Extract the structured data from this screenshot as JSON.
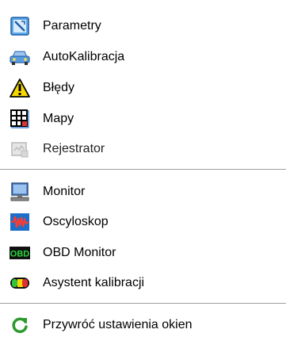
{
  "menu": {
    "items": [
      {
        "label": "Parametry",
        "icon": "parameters-icon"
      },
      {
        "label": "AutoKalibracja",
        "icon": "car-icon"
      },
      {
        "label": "Błędy",
        "icon": "warning-icon"
      },
      {
        "label": "Mapy",
        "icon": "map-grid-icon"
      },
      {
        "label": "Rejestrator",
        "icon": "recorder-icon",
        "disabled": true
      },
      {
        "label": "Monitor",
        "icon": "monitor-icon"
      },
      {
        "label": "Oscyloskop",
        "icon": "oscilloscope-icon"
      },
      {
        "label": "OBD Monitor",
        "icon": "obd-icon",
        "icon_text": "OBD"
      },
      {
        "label": "Asystent kalibracji",
        "icon": "calibration-assistant-icon"
      },
      {
        "label": "Przywróć ustawienia okien",
        "icon": "refresh-icon"
      }
    ]
  },
  "colors": {
    "background": "#ffffff",
    "separator": "#a0a0a0",
    "accent_blue": "#1e6fc9",
    "warning_yellow": "#f5d800",
    "obd_green": "#1a8a1a",
    "refresh_green": "#2e9a2e"
  }
}
